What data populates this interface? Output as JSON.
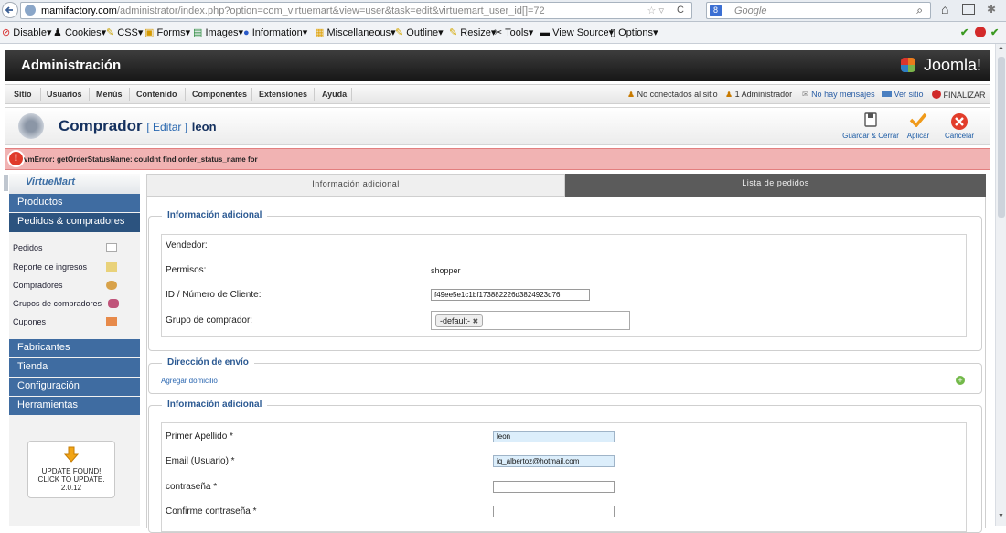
{
  "browser": {
    "url_host": "mamifactory.com",
    "url_path": "/administrator/index.php?option=com_virtuemart&view=user&task=edit&virtuemart_user_id[]=72",
    "search_placeholder": "Google",
    "toolbar_items": [
      "Disable▾",
      "Cookies▾",
      "CSS▾",
      "Forms▾",
      "Images▾",
      "Information▾",
      "Miscellaneous▾",
      "Outline▾",
      "Resize▾",
      "Tools▾",
      "View Source▾",
      "Options▾"
    ]
  },
  "header": {
    "title": "Administración",
    "logo": "Joomla!"
  },
  "menu": {
    "items": [
      "Sitio",
      "Usuarios",
      "Menús",
      "Contenido",
      "Componentes",
      "Extensiones",
      "Ayuda"
    ],
    "status": [
      "No conectados al sitio",
      "1 Administrador",
      "No hay mensajes",
      "Ver sitio",
      "FINALIZAR"
    ]
  },
  "titlebar": {
    "title": "Comprador",
    "edit": "[ Editar ]",
    "user": "leon",
    "buttons": {
      "save_close": "Guardar & Cerrar",
      "apply": "Aplicar",
      "cancel": "Cancelar"
    }
  },
  "error": "vmError: getOrderStatusName: couldnt find order_status_name for",
  "sidebar": {
    "logo": "VirtueMart",
    "products": "Productos",
    "orders_section": "Pedidos & compradores",
    "sub_items": [
      "Pedidos",
      "Reporte de ingresos",
      "Compradores",
      "Grupos de compradores",
      "Cupones"
    ],
    "sections": [
      "Fabricantes",
      "Tienda",
      "Configuración",
      "Herramientas"
    ],
    "update": {
      "line1": "UPDATE FOUND!",
      "line2": "CLICK TO UPDATE.",
      "version": "2.0.12"
    }
  },
  "tabs": {
    "active": "Información adicional",
    "inactive": "Lista de pedidos"
  },
  "info_section": {
    "legend": "Información adicional",
    "vendor_label": "Vendedor:",
    "perms_label": "Permisos:",
    "perms_value": "shopper",
    "customer_id_label": "ID / Número de Cliente:",
    "customer_id_value": "f49ee5e1c1bf173882226d3824923d76",
    "group_label": "Grupo de comprador:",
    "group_tag": "-default-"
  },
  "shipping": {
    "legend": "Dirección de envío",
    "add_link": "Agregar domicilio"
  },
  "address_section": {
    "legend": "Información adicional",
    "last_name_label": "Primer Apellido *",
    "last_name_value": "leon",
    "email_label": "Email (Usuario) *",
    "email_value": "iq_albertoz@hotmail.com",
    "password_label": "contraseña *",
    "confirm_label": "Confirme contraseña *"
  },
  "colors": {
    "sidebar_blue": "#3f6ca1",
    "legend_blue": "#2c5a93",
    "error_bg": "#f1b3b3"
  }
}
